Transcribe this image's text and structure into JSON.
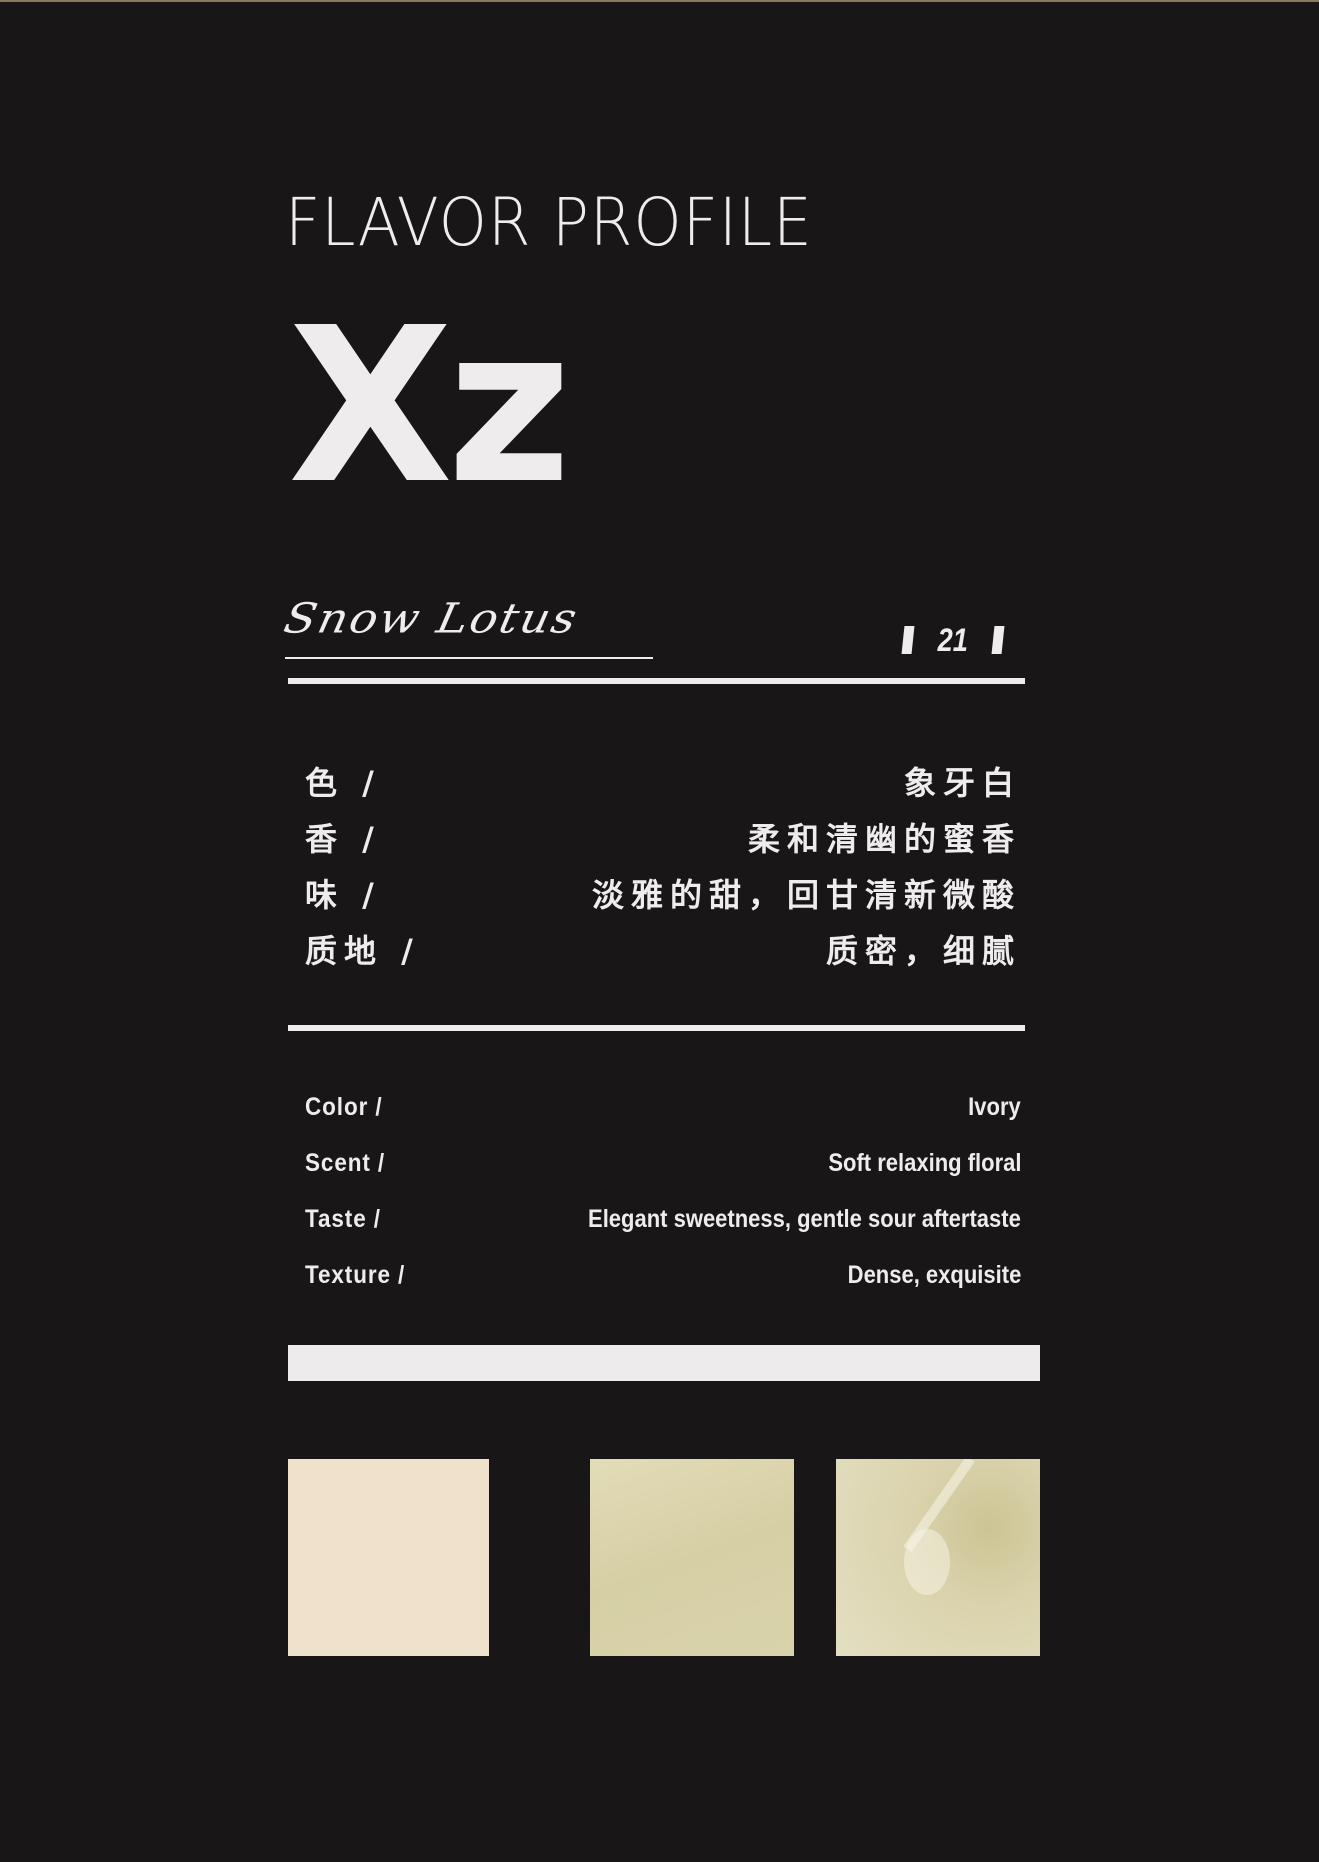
{
  "header": {
    "title": "FLAVOR PROFILE",
    "code": "Xz",
    "signature": "Snow Lotus",
    "number": "21"
  },
  "chinese": [
    {
      "label": "色 /",
      "value": "象牙白"
    },
    {
      "label": "香 /",
      "value": "柔和清幽的蜜香"
    },
    {
      "label": "味 /",
      "value": "淡雅的甜，回甘清新微酸"
    },
    {
      "label": "质地 /",
      "value": "质密，细腻"
    }
  ],
  "english": [
    {
      "label": "Color /",
      "value": "Ivory"
    },
    {
      "label": "Scent /",
      "value": "Soft relaxing floral"
    },
    {
      "label": "Taste /",
      "value": "Elegant sweetness, gentle sour aftertaste"
    },
    {
      "label": "Texture /",
      "value": "Dense, exquisite"
    }
  ],
  "colors": {
    "background": "#181617",
    "text": "#eeeced",
    "swatch_ivory": "#efe1cc",
    "swatch_liquid": "#d9d3ac"
  }
}
